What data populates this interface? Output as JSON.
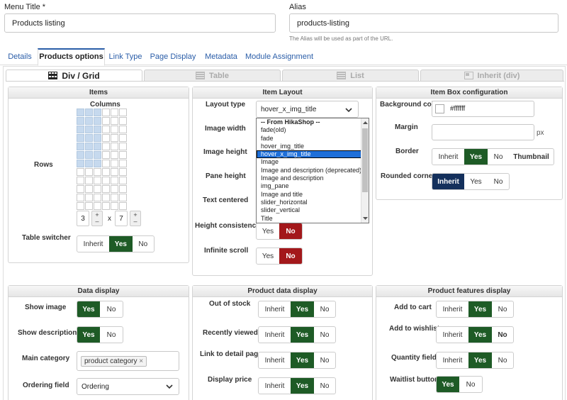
{
  "form": {
    "menu_title_label": "Menu Title *",
    "menu_title_value": "Products listing",
    "alias_label": "Alias",
    "alias_value": "products-listing",
    "alias_hint": "The Alias will be used as part of the URL."
  },
  "tabs": [
    "Details",
    "Products options",
    "Link Type",
    "Page Display",
    "Metadata",
    "Module Assignment"
  ],
  "subtabs": [
    "Div / Grid",
    "Table",
    "List",
    "Inherit (div)"
  ],
  "items": {
    "title": "Items",
    "columns_label": "Columns",
    "rows_label": "Rows",
    "rows_value": "3",
    "cols_value": "7",
    "times": "x",
    "plus": "+",
    "minus": "–",
    "table_switcher_label": "Table switcher"
  },
  "item_layout": {
    "title": "Item Layout",
    "layout_type_label": "Layout type",
    "layout_type_value": "hover_x_img_title",
    "image_width_label": "Image width",
    "image_height_label": "Image height",
    "pane_height_label": "Pane height",
    "text_centered_label": "Text centered",
    "height_consistency_label": "Height consistency",
    "infinite_scroll_label": "Infinite scroll",
    "options": [
      "-- From HikaShop --",
      "fade(old)",
      "fade",
      "hover_img_title",
      "hover_x_img_title",
      "Image",
      "Image and description (deprecated)",
      "Image and description",
      "img_pane",
      "Image and title",
      "slider_horizontal",
      "slider_vertical",
      "Title"
    ]
  },
  "item_box": {
    "title": "Item Box configuration",
    "bg_color_label": "Background color",
    "bg_color_value": "#ffffff",
    "margin_label": "Margin",
    "margin_unit": "px",
    "border_label": "Border",
    "rounded_label": "Rounded corners"
  },
  "data_display": {
    "title": "Data display",
    "show_image_label": "Show image",
    "show_description_label": "Show description",
    "main_category_label": "Main category",
    "main_category_chip": "product category",
    "chip_remove": "×",
    "ordering_field_label": "Ordering field",
    "ordering_field_value": "Ordering"
  },
  "product_data": {
    "title": "Product data display",
    "out_of_stock_label": "Out of stock",
    "recently_viewed_label": "Recently viewed",
    "link_detail_label": "Link to detail page",
    "display_price_label": "Display price"
  },
  "product_features": {
    "title": "Product features display",
    "add_to_cart_label": "Add to cart",
    "add_to_wishlist_label": "Add to wishlist",
    "quantity_field_label": "Quantity field",
    "waitlist_label": "Waitlist button"
  },
  "btn": {
    "inherit": "Inherit",
    "yes": "Yes",
    "no": "No",
    "thumbnail": "Thumbnail"
  },
  "colors": {
    "accent": "#2a5da8",
    "yes_green": "#1e5b26",
    "no_red": "#a3181b",
    "inherit_blue": "#14305c"
  }
}
